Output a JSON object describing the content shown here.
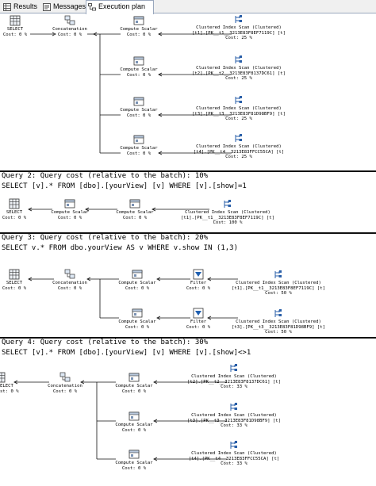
{
  "tabs": [
    {
      "label": "Results",
      "icon": "grid-icon",
      "active": false
    },
    {
      "label": "Messages",
      "icon": "message-icon",
      "active": false
    },
    {
      "label": "Execution plan",
      "icon": "execution-plan-icon",
      "active": true
    }
  ],
  "q1": {
    "select": {
      "title": "SELECT",
      "cost": "Cost: 0 %"
    },
    "concat": {
      "title": "Concatenation",
      "cost": "Cost: 0 %"
    },
    "branches": [
      {
        "cs_title": "Compute Scalar",
        "cs_cost": "Cost: 0 %",
        "scan_title": "Clustered Index Scan (Clustered)",
        "scan_obj": "[t1].[PK__t1__3213E83F8EF7119C] [t]",
        "scan_cost": "Cost: 25 %"
      },
      {
        "cs_title": "Compute Scalar",
        "cs_cost": "Cost: 0 %",
        "scan_title": "Clustered Index Scan (Clustered)",
        "scan_obj": "[t2].[PK__t2__3213E83F8137DC61] [t]",
        "scan_cost": "Cost: 25 %"
      },
      {
        "cs_title": "Compute Scalar",
        "cs_cost": "Cost: 0 %",
        "scan_title": "Clustered Index Scan (Clustered)",
        "scan_obj": "[t3].[PK__t3__3213E83F81D98BF9] [t]",
        "scan_cost": "Cost: 25 %"
      },
      {
        "cs_title": "Compute Scalar",
        "cs_cost": "Cost: 0 %",
        "scan_title": "Clustered Index Scan (Clustered)",
        "scan_obj": "[t4].[PK__t4__3213E83FFCC55CA] [t]",
        "scan_cost": "Cost: 25 %"
      }
    ]
  },
  "q2": {
    "header": "Query 2: Query cost (relative to the batch): 10%",
    "sql": "SELECT [v].* FROM [dbo].[yourView] [v] WHERE [v].[show]=1",
    "select": {
      "title": "SELECT",
      "cost": "Cost: 0 %"
    },
    "cs1": {
      "title": "Compute Scalar",
      "cost": "Cost: 0 %"
    },
    "cs2": {
      "title": "Compute Scalar",
      "cost": "Cost: 0 %"
    },
    "scan": {
      "title": "Clustered Index Scan (Clustered)",
      "obj": "[t1].[PK__t1__3213E83F8EF7119C] [t]",
      "cost": "Cost: 100 %"
    }
  },
  "q3": {
    "header": "Query 3: Query cost (relative to the batch): 20%",
    "sql": "SELECT v.* FROM dbo.yourView AS v WHERE v.show IN (1,3)",
    "select": {
      "title": "SELECT",
      "cost": "Cost: 0 %"
    },
    "concat": {
      "title": "Concatenation",
      "cost": "Cost: 0 %"
    },
    "branches": [
      {
        "cs_title": "Compute Scalar",
        "cs_cost": "Cost: 0 %",
        "filter_title": "Filter",
        "filter_cost": "Cost: 0 %",
        "scan_title": "Clustered Index Scan (Clustered)",
        "scan_obj": "[t1].[PK__t1__3213E83F8EF7119C] [t]",
        "scan_cost": "Cost: 50 %"
      },
      {
        "cs_title": "Compute Scalar",
        "cs_cost": "Cost: 0 %",
        "filter_title": "Filter",
        "filter_cost": "Cost: 0 %",
        "scan_title": "Clustered Index Scan (Clustered)",
        "scan_obj": "[t3].[PK__t3__3213E83F81D98BF9] [t]",
        "scan_cost": "Cost: 50 %"
      }
    ]
  },
  "q4": {
    "header": "Query 4: Query cost (relative to the batch): 30%",
    "sql": "SELECT [v].* FROM [dbo].[yourView] [v] WHERE [v].[show]<>1",
    "select": {
      "title": "ELECT",
      "cost": "st: 0 %"
    },
    "concat": {
      "title": "Concatenation",
      "cost": "Cost: 0 %"
    },
    "branches": [
      {
        "cs_title": "Compute Scalar",
        "cs_cost": "Cost: 0 %",
        "scan_title": "Clustered Index Scan (Clustered)",
        "scan_obj": "[t2].[PK__t2__3213E83F8137DC61] [t]",
        "scan_cost": "Cost: 33 %"
      },
      {
        "cs_title": "Compute Scalar",
        "cs_cost": "Cost: 0 %",
        "scan_title": "Clustered Index Scan (Clustered)",
        "scan_obj": "[t3].[PK__t3__3213E83F81D98BF9] [t]",
        "scan_cost": "Cost: 33 %"
      },
      {
        "cs_title": "Compute Scalar",
        "cs_cost": "Cost: 0 %",
        "scan_title": "Clustered Index Scan (Clustered)",
        "scan_obj": "[t4].[PK__t4__3213E83FFCC55CA] [t]",
        "scan_cost": "Cost: 33 %"
      }
    ]
  }
}
